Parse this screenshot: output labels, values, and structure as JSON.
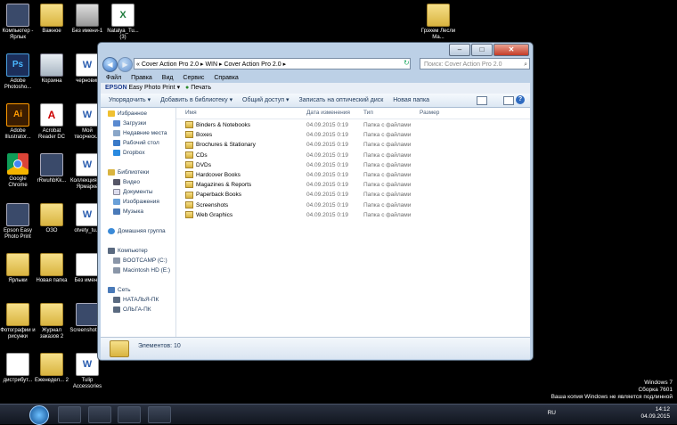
{
  "desktop_icons": [
    {
      "id": "computer",
      "label": "Компьютер - Ярлык",
      "kind": "screen"
    },
    {
      "id": "vazhnoe",
      "label": "Важное",
      "kind": "folder"
    },
    {
      "id": "bez1",
      "label": "Без имени-1",
      "kind": "cab"
    },
    {
      "id": "natalya",
      "label": "Natalya_Tu... (3)",
      "kind": "xls"
    },
    {
      "id": "ps",
      "label": "Adobe Photosho...",
      "kind": "ps"
    },
    {
      "id": "korzina",
      "label": "Корзина",
      "kind": "bin"
    },
    {
      "id": "chernov",
      "label": "черновик",
      "kind": "word"
    },
    {
      "id": "ai",
      "label": "Adobe Illustrator...",
      "kind": "ai"
    },
    {
      "id": "acrobat",
      "label": "Acrobat Reader DC",
      "kind": "pdf"
    },
    {
      "id": "moy",
      "label": "Мой творческ...",
      "kind": "word"
    },
    {
      "id": "chrome",
      "label": "Google Chrome",
      "kind": "chrome"
    },
    {
      "id": "rwuh",
      "label": "rRwuhbKk...",
      "kind": "screen"
    },
    {
      "id": "kollek",
      "label": "Коллекция на Ярмарке",
      "kind": "word"
    },
    {
      "id": "epson",
      "label": "Epson Easy Photo Print",
      "kind": "screen"
    },
    {
      "id": "ozo",
      "label": "ОЗО",
      "kind": "folder"
    },
    {
      "id": "otvety",
      "label": "otvety_tu...",
      "kind": "word"
    },
    {
      "id": "yarlyki",
      "label": "Ярлыки",
      "kind": "folder"
    },
    {
      "id": "novpap",
      "label": "Новая папка",
      "kind": "folder"
    },
    {
      "id": "bezim",
      "label": "Без имени",
      "kind": "doc"
    },
    {
      "id": "foto",
      "label": "Фотографии и рисунки",
      "kind": "folder"
    },
    {
      "id": "zhurnal",
      "label": "Журнал заказов 2",
      "kind": "folder"
    },
    {
      "id": "screensh",
      "label": "Screenshot (1)",
      "kind": "screen"
    },
    {
      "id": "distr",
      "label": "дистрибут...",
      "kind": "doc"
    },
    {
      "id": "ezhened",
      "label": "Еженедел... 2",
      "kind": "folder"
    },
    {
      "id": "tulip",
      "label": "Tulip Accessories",
      "kind": "word"
    },
    {
      "id": "grahem",
      "label": "Грэхем Лесли Ма...",
      "kind": "folder"
    }
  ],
  "window": {
    "address": "« Cover Action Pro 2.0 ▸ WIN ▸ Cover Action Pro 2.0 ▸",
    "search_placeholder": "Поиск: Cover Action Pro 2.0",
    "menu": [
      "Файл",
      "Правка",
      "Вид",
      "Сервис",
      "Справка"
    ],
    "epson_logo": "EPSON",
    "epson_app": "Easy Photo Print",
    "epson_print": "Печать",
    "commands": [
      "Упорядочить ▾",
      "Добавить в библиотеку ▾",
      "Общий доступ ▾",
      "Записать на оптический диск",
      "Новая папка"
    ],
    "nav": {
      "favorites": "Избранное",
      "fav_items": [
        "Загрузки",
        "Недавние места",
        "Рабочий стол",
        "Dropbox"
      ],
      "libraries": "Библиотеки",
      "lib_items": [
        "Видео",
        "Документы",
        "Изображения",
        "Музыка"
      ],
      "homegroup": "Домашняя группа",
      "computer": "Компьютер",
      "comp_items": [
        "BOOTCAMP (C:)",
        "Macintosh HD (E:)"
      ],
      "network": "Сеть",
      "net_items": [
        "НАТАЛЬЯ-ПК",
        "ОЛЬГА-ПК"
      ]
    },
    "columns": [
      "Имя",
      "Дата изменения",
      "Тип",
      "Размер"
    ],
    "files": [
      {
        "name": "Binders & Notebooks",
        "date": "04.09.2015 0:19",
        "type": "Папка с файлами"
      },
      {
        "name": "Boxes",
        "date": "04.09.2015 0:19",
        "type": "Папка с файлами"
      },
      {
        "name": "Brochures & Stationary",
        "date": "04.09.2015 0:19",
        "type": "Папка с файлами"
      },
      {
        "name": "CDs",
        "date": "04.09.2015 0:19",
        "type": "Папка с файлами"
      },
      {
        "name": "DVDs",
        "date": "04.09.2015 0:19",
        "type": "Папка с файлами"
      },
      {
        "name": "Hardcover Books",
        "date": "04.09.2015 0:19",
        "type": "Папка с файлами"
      },
      {
        "name": "Magazines & Reports",
        "date": "04.09.2015 0:19",
        "type": "Папка с файлами"
      },
      {
        "name": "Paperback Books",
        "date": "04.09.2015 0:19",
        "type": "Папка с файлами"
      },
      {
        "name": "Screenshots",
        "date": "04.09.2015 0:19",
        "type": "Папка с файлами"
      },
      {
        "name": "Web Graphics",
        "date": "04.09.2015 0:19",
        "type": "Папка с файлами"
      }
    ],
    "status": "Элементов: 10"
  },
  "taskbar": {
    "lang": "RU",
    "time": "14:12",
    "date": "04.09.2015"
  },
  "watermark": [
    "Windows 7",
    "Сборка 7601",
    "Ваша копия Windows не является подлинной"
  ]
}
